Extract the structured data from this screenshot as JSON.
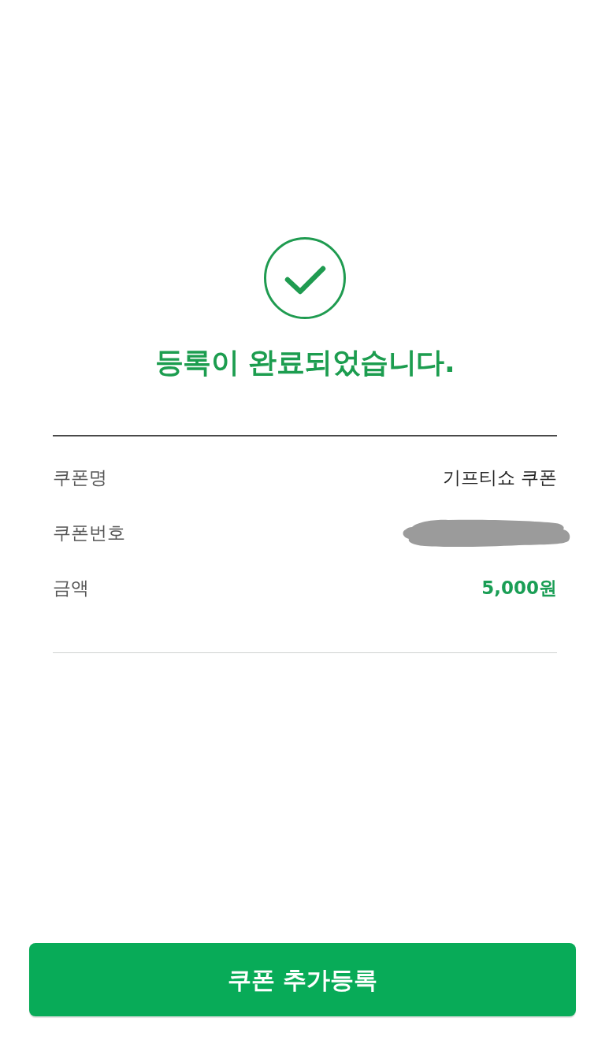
{
  "title": "등록이 완료되었습니다.",
  "details": [
    {
      "label": "쿠폰명",
      "kind": "text",
      "value": "기프티쇼 쿠폰"
    },
    {
      "label": "쿠폰번호",
      "kind": "redacted"
    },
    {
      "label": "금액",
      "kind": "amount",
      "value": "5,000원"
    }
  ],
  "button": {
    "label": "쿠폰 추가등록"
  }
}
